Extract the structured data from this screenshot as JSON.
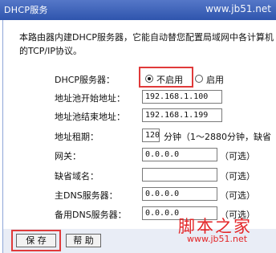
{
  "window": {
    "title": "DHCP服务",
    "watermark_top": "www.jb51.net"
  },
  "description": "本路由器内建DHCP服务器，它能自动替您配置局域网中各计算机的TCP/IP协议。",
  "form": {
    "dhcp_label": "DHCP服务器：",
    "dhcp_options": [
      {
        "label": "不启用",
        "checked": true
      },
      {
        "label": "启用",
        "checked": false
      }
    ],
    "start_label": "地址池开始地址：",
    "start_value": "192.168.1.100",
    "end_label": "地址池结束地址：",
    "end_value": "192.168.1.199",
    "lease_label": "地址租期：",
    "lease_value": "120",
    "lease_note": "分钟（1～2880分钟，缺省",
    "gateway_label": "网关：",
    "gateway_value": "0.0.0.0",
    "gateway_note": "（可选）",
    "domain_label": "缺省域名：",
    "domain_value": "",
    "domain_note": "（可选）",
    "dns1_label": "主DNS服务器：",
    "dns1_value": "0.0.0.0",
    "dns1_note": "（可选）",
    "dns2_label": "备用DNS服务器：",
    "dns2_value": "0.0.0.0",
    "dns2_note": "（可选）"
  },
  "buttons": {
    "save": "保 存",
    "help": "帮 助"
  },
  "watermark": {
    "cn": "脚本之家",
    "url": "www.jb51.net"
  },
  "colors": {
    "titlebar": "#2f55ad",
    "highlight": "#e03a3a",
    "watermark": "#e32426"
  }
}
